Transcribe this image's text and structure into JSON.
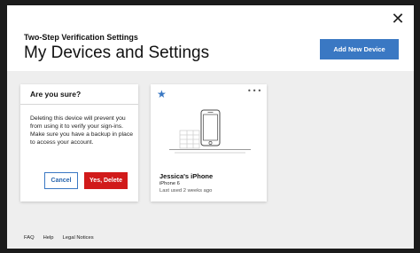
{
  "header": {
    "subtitle": "Two-Step Verification Settings",
    "title": "My Devices and Settings",
    "add_device_label": "Add New Device",
    "close_symbol": "✕"
  },
  "confirm": {
    "heading": "Are you sure?",
    "message": "Deleting this device will prevent you from using it to verify your sign-ins. Make sure you have a backup in place to access your account.",
    "cancel_label": "Cancel",
    "delete_label": "Yes, Delete"
  },
  "device": {
    "star_symbol": "★",
    "more_symbol": "•••",
    "name": "Jessica's iPhone",
    "model": "iPhone 6",
    "last_used": "Last used 2 weeks ago",
    "icon": "phone-icon"
  },
  "footer": {
    "links": [
      "FAQ",
      "Help",
      "Legal Notices"
    ]
  },
  "colors": {
    "accent": "#3a78c3",
    "danger": "#d11a1a",
    "overlay": "#1b1b1b",
    "content_bg": "#eeeeee"
  }
}
